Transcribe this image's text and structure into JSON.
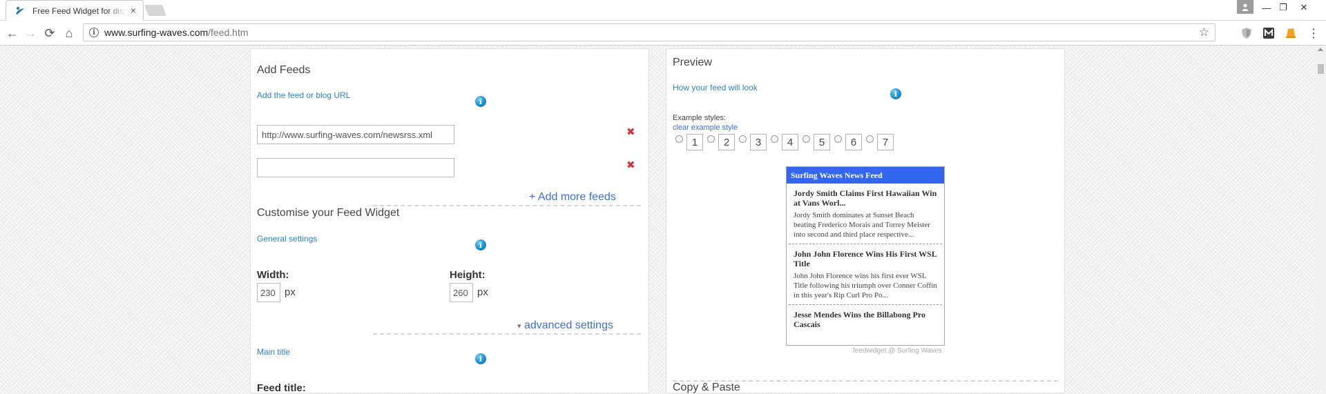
{
  "browser": {
    "tab_title": "Free Feed Widget for display",
    "tab_close": "×",
    "url_host": "www.surfing-waves.com",
    "url_path": "/feed.htm",
    "info_glyph": "i",
    "star_glyph": "☆",
    "back_glyph": "←",
    "forward_glyph": "→",
    "reload_glyph": "⟳",
    "home_glyph": "⌂",
    "minimize_glyph": "—",
    "restore_glyph": "❐",
    "close_glyph": "✕",
    "menu_glyph": "⋮",
    "user_glyph": "👤"
  },
  "add_feeds": {
    "heading": "Add Feeds",
    "sublabel": "Add the feed or blog URL",
    "feed_url_1": "http://www.surfing-waves.com/newsrss.xml",
    "feed_url_2": "",
    "remove_glyph": "✖",
    "add_more": "+ Add more feeds"
  },
  "customise": {
    "heading": "Customise your Feed Widget",
    "general_settings": "General settings",
    "width_label": "Width:",
    "width_value": "230",
    "height_label": "Height:",
    "height_value": "260",
    "unit": "px",
    "advanced": "advanced settings",
    "advanced_arrow": "▾",
    "main_title": "Main title",
    "feed_title_label": "Feed title:"
  },
  "preview": {
    "heading": "Preview",
    "sublabel": "How your feed will look",
    "example_styles": "Example styles:",
    "clear_style": "clear example style",
    "styles": [
      "1",
      "2",
      "3",
      "4",
      "5",
      "6",
      "7"
    ],
    "widget_title": "Surfing Waves News Feed",
    "items": [
      {
        "title": "Jordy Smith Claims First Hawaiian Win at Vans Worl...",
        "desc": "Jordy Smith dominates at Sunset Beach beating Frederico Morais and Torrey Meister into second and third place respective..."
      },
      {
        "title": "John John Florence Wins His First WSL Title",
        "desc": "John John Florence wins his first ever WSL Title following his triumph over Conner Coffin in this year's Rip Curl Pro Po..."
      },
      {
        "title": "Jesse Mendes Wins the Billabong Pro Cascais",
        "desc": ""
      }
    ],
    "credit": "feedwidget @ Surfing Waves",
    "copy_paste": "Copy & Paste"
  },
  "info_icon_glyph": "i",
  "colors": {
    "accent": "#3366ee",
    "link": "#2f82c8",
    "remove": "#d63333"
  }
}
